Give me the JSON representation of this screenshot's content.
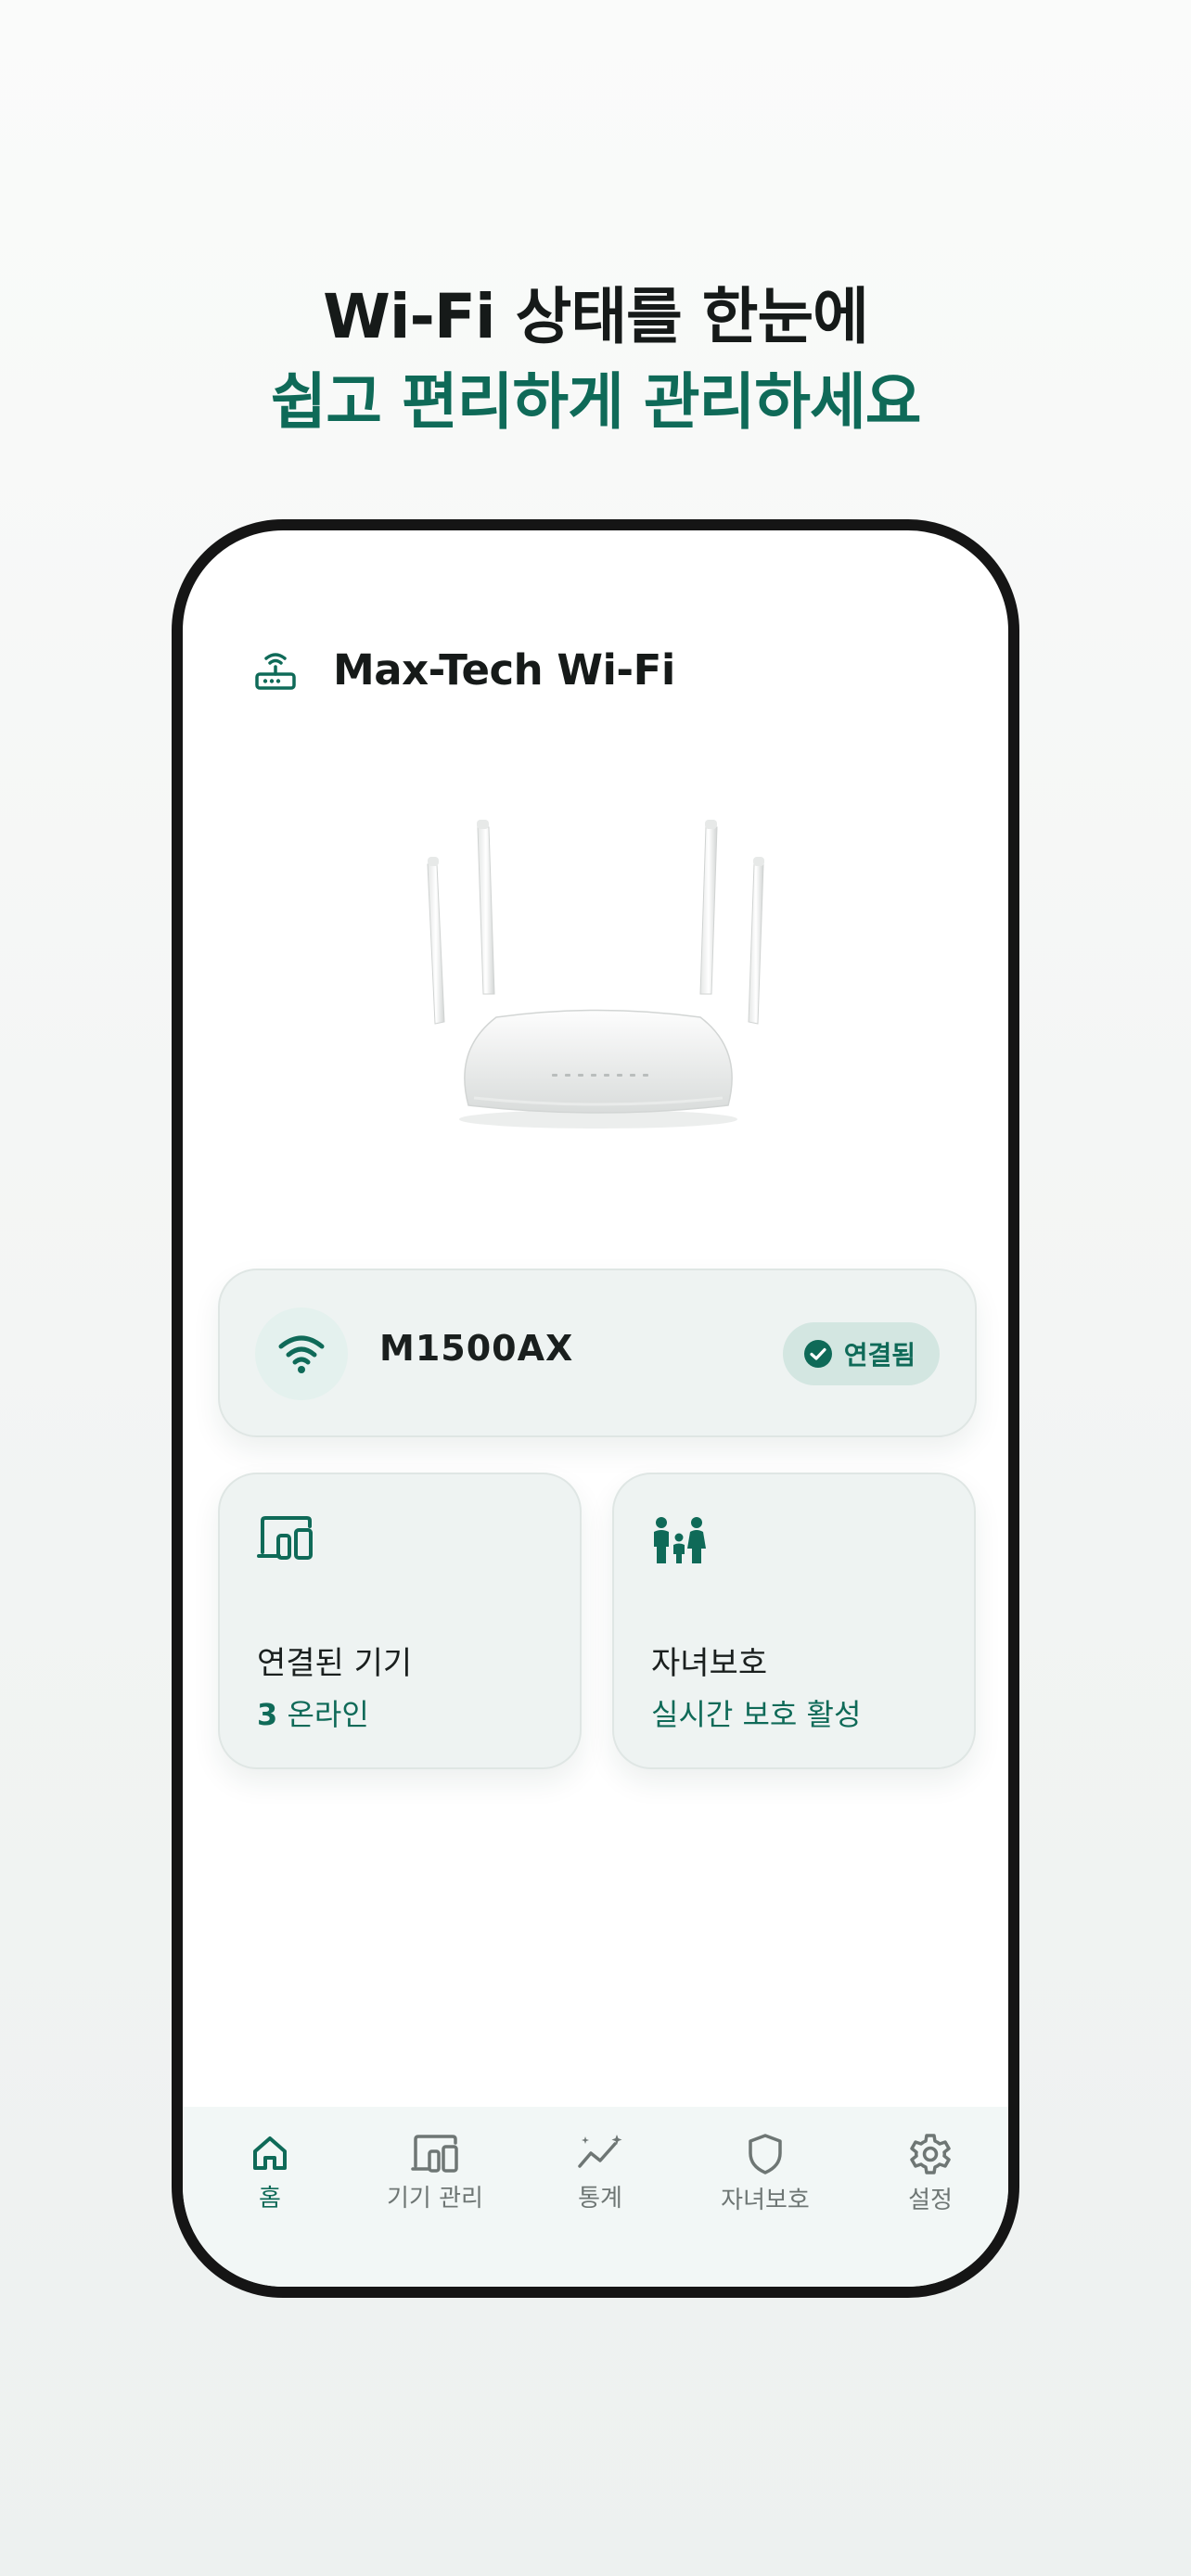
{
  "headline": {
    "line1": "Wi-Fi 상태를 한눈에",
    "line2": "쉽고 편리하게 관리하세요"
  },
  "app": {
    "title": "Max-Tech Wi-Fi",
    "icon": "router-icon"
  },
  "device": {
    "model": "M1500AX",
    "status": "연결됨",
    "icon": "wifi-icon"
  },
  "cards": [
    {
      "title": "연결된 기기",
      "count": "3",
      "value": "온라인",
      "icon": "devices-icon"
    },
    {
      "title": "자녀보호",
      "value": "실시간 보호 활성",
      "icon": "family-icon"
    }
  ],
  "tabs": [
    {
      "label": "홈",
      "icon": "home-icon",
      "active": true
    },
    {
      "label": "기기 관리",
      "icon": "devices-icon",
      "active": false
    },
    {
      "label": "통계",
      "icon": "stats-icon",
      "active": false
    },
    {
      "label": "자녀보호",
      "icon": "shield-icon",
      "active": false
    },
    {
      "label": "설정",
      "icon": "gear-icon",
      "active": false
    }
  ],
  "colors": {
    "accent": "#0f6a58",
    "card_bg": "#eef3f2",
    "status_pill_bg": "#d3e6e1"
  }
}
